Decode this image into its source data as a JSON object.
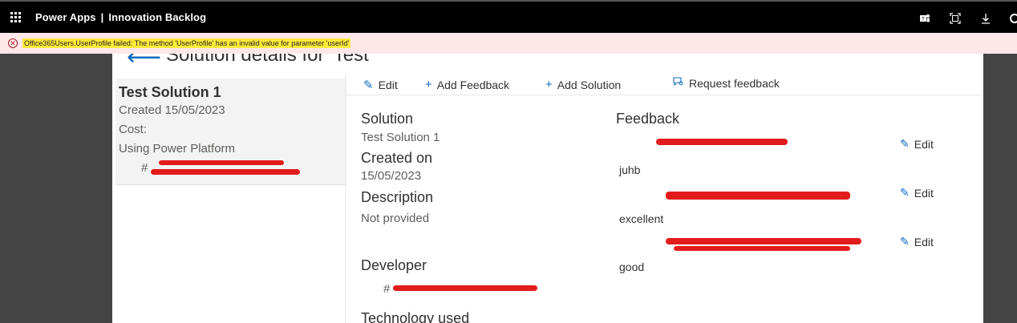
{
  "topbar": {
    "app_name": "Power Apps",
    "separator": "|",
    "app_title": "Innovation Backlog",
    "icons": [
      "waffle-icon",
      "teams-icon",
      "expand-icon",
      "download-icon",
      "settings-icon"
    ]
  },
  "error": {
    "message": "Office365Users.UserProfile failed: The method 'UserProfile' has an invalid value for parameter 'userId'"
  },
  "header": {
    "title": "Solution details for 'Test'"
  },
  "left_panel": {
    "title": "Test Solution 1",
    "created": "Created 15/05/2023",
    "cost": "Cost:",
    "using": "Using Power Platform",
    "owner_prefix": "#"
  },
  "commands": {
    "edit": "Edit",
    "add_feedback": "Add Feedback",
    "add_solution": "Add Solution",
    "request_feedback": "Request feedback"
  },
  "details": {
    "solution_label": "Solution",
    "solution_value": "Test Solution 1",
    "created_label": "Created on",
    "created_value": "15/05/2023",
    "description_label": "Description",
    "description_value": "Not provided",
    "developer_label": "Developer",
    "developer_prefix": "#",
    "technology_label": "Technology used"
  },
  "feedback": {
    "label": "Feedback",
    "edit_label": "Edit",
    "items": [
      {
        "text": "juhb"
      },
      {
        "text": "excellent"
      },
      {
        "text": "good"
      }
    ]
  }
}
